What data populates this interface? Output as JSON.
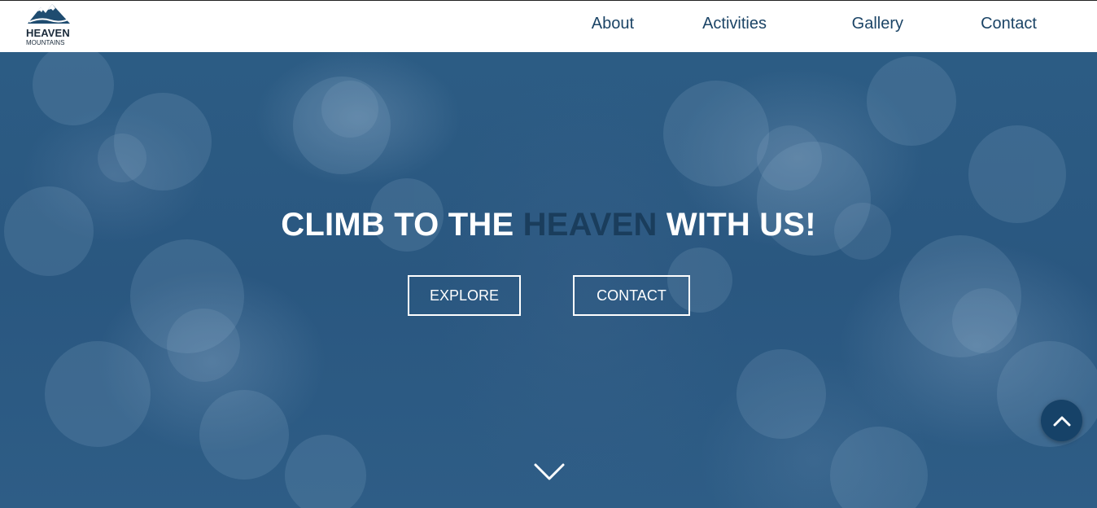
{
  "brand": {
    "name_line1": "HEAVEN",
    "name_line2": "MOUNTAINS",
    "logo_icon": "mountain-icon"
  },
  "nav": {
    "items": [
      {
        "label": "About"
      },
      {
        "label": "Activities"
      },
      {
        "label": "Gallery"
      },
      {
        "label": "Contact"
      }
    ]
  },
  "hero": {
    "headline_before": "CLIMB TO THE ",
    "headline_accent": "HEAVEN",
    "headline_after": " WITH US!",
    "explore_label": "EXPLORE",
    "contact_label": "CONTACT",
    "scroll_icon": "chevron-down-icon"
  },
  "back_to_top": {
    "icon": "chevron-up-icon"
  },
  "colors": {
    "nav_text": "#1b4466",
    "hero_overlay": "#2b5a82",
    "accent_text": "#1a3d5c",
    "back_to_top_bg": "#164268"
  }
}
